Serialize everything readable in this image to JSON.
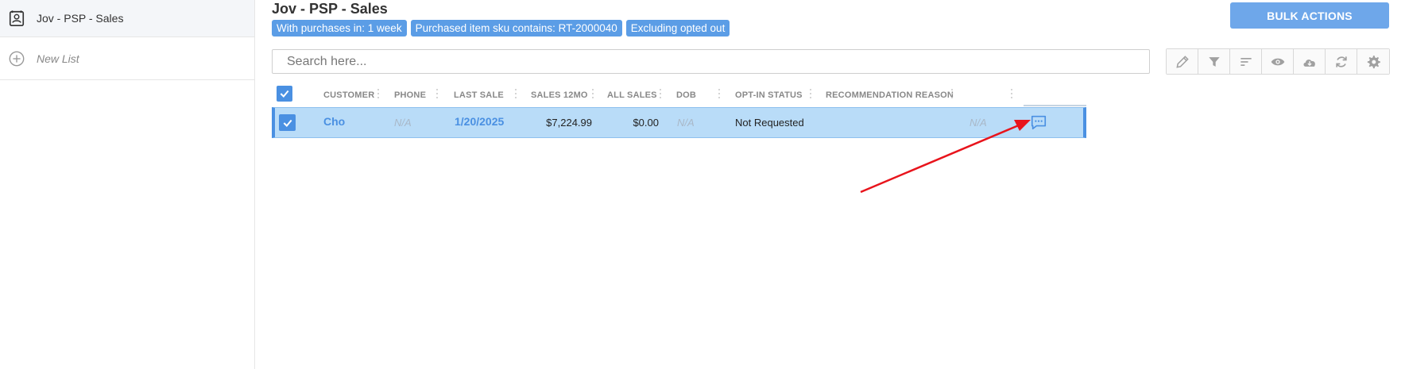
{
  "sidebar": {
    "items": [
      {
        "label": "Jov - PSP - Sales",
        "icon": "contact-card-icon"
      },
      {
        "label": "New List",
        "icon": "plus-circle-icon"
      }
    ]
  },
  "header": {
    "title": "Jov - PSP - Sales",
    "filters": [
      "With purchases in: 1 week",
      "Purchased item sku contains: RT-2000040",
      "Excluding opted out"
    ],
    "bulk_actions_label": "BULK ACTIONS"
  },
  "search": {
    "placeholder": "Search here..."
  },
  "toolbar": {
    "buttons": [
      "pencil-icon",
      "filter-icon",
      "sort-icon",
      "eye-icon",
      "cloud-download-icon",
      "refresh-icon",
      "gear-icon"
    ]
  },
  "table": {
    "columns": [
      "CUSTOMER",
      "PHONE",
      "LAST SALE",
      "SALES 12MO",
      "ALL SALES",
      "DOB",
      "OPT-IN STATUS",
      "RECOMMENDATION REASON"
    ],
    "rows": [
      {
        "customer": "Cho",
        "phone": "N/A",
        "last_sale": "1/20/2025",
        "sales_12mo": "$7,224.99",
        "all_sales": "$0.00",
        "dob": "N/A",
        "opt_in_status": "Not Requested",
        "recommendation_reason": "N/A",
        "selected": true
      }
    ]
  },
  "colors": {
    "accent": "#4a90e2",
    "row_selected": "#b9dcf8",
    "chip": "#5b9de6",
    "annotation_arrow": "#e8141c"
  }
}
